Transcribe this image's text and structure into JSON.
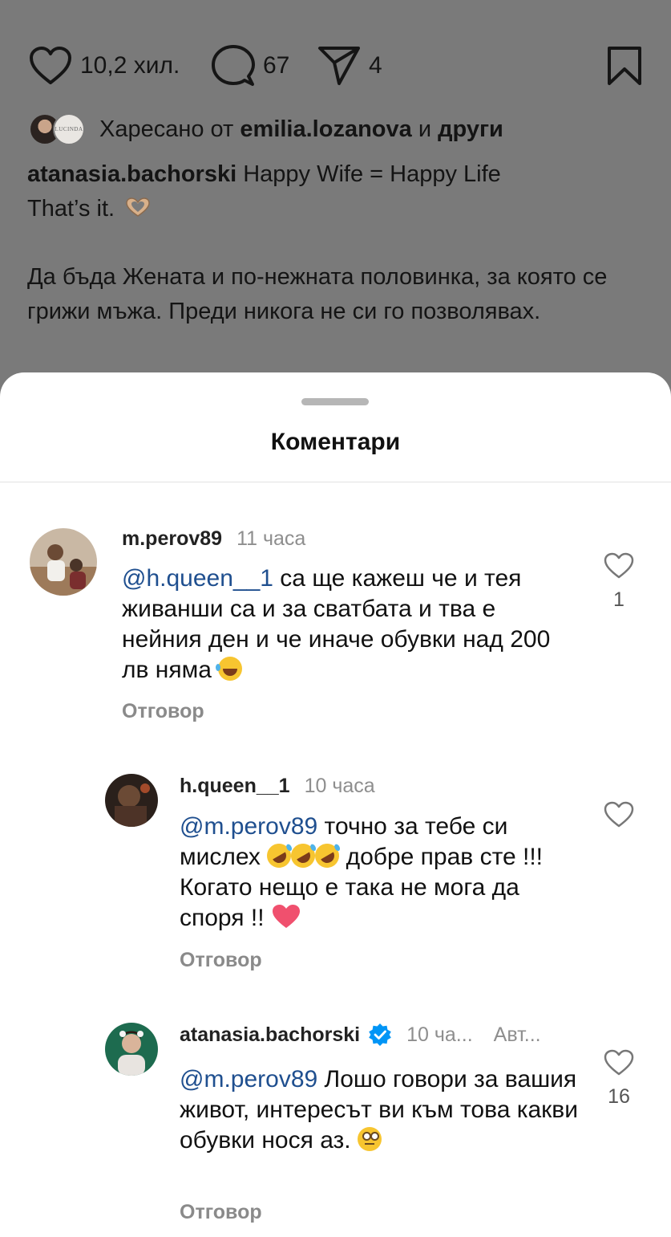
{
  "post": {
    "likes": "10,2 хил.",
    "comments_count": "67",
    "shares": "4",
    "liked_by_prefix": "Харесано от",
    "liked_by_user": "emilia.lozanova",
    "liked_by_and": "и",
    "liked_by_others": "други",
    "second_avatar_text": "LUCINDA",
    "caption_user": "atanasia.bachorski",
    "caption_line1": "Happy Wife = Happy Life",
    "caption_line2": "That’s it.",
    "caption_line3": "Да бъда Жената и по-нежната половинка, за която се грижи мъжа. Преди никога не си го позволявах."
  },
  "sheet": {
    "title": "Коментари"
  },
  "comments": [
    {
      "user": "m.perov89",
      "time": "11 часа",
      "mention": "@h.queen__1",
      "text": "са ще кажеш че и тея живанши са и за сватбата и тва е нейния ден и че иначе обувки над 200 лв няма",
      "likes": "1",
      "reply": "Отговор"
    },
    {
      "user": "h.queen__1",
      "time": "10 часа",
      "mention": "@m.perov89",
      "text_a": "точно за тебе си мислех",
      "text_b": "добре прав сте !!! Когато нещо е така не мога да споря !!",
      "likes": "",
      "reply": "Отговор"
    },
    {
      "user": "atanasia.bachorski",
      "time": "10 ча...",
      "author": "Авт...",
      "mention": "@m.perov89",
      "text": "Лошо говори за вашия живот, интересът ви към това какви обувки нося аз.",
      "likes": "16",
      "reply": "Отговор"
    }
  ],
  "colors": {
    "overlay": "#7a7a7a",
    "mention": "#1f4f8f",
    "verified": "#0095f6",
    "heart_emoji": "#f0506e"
  }
}
